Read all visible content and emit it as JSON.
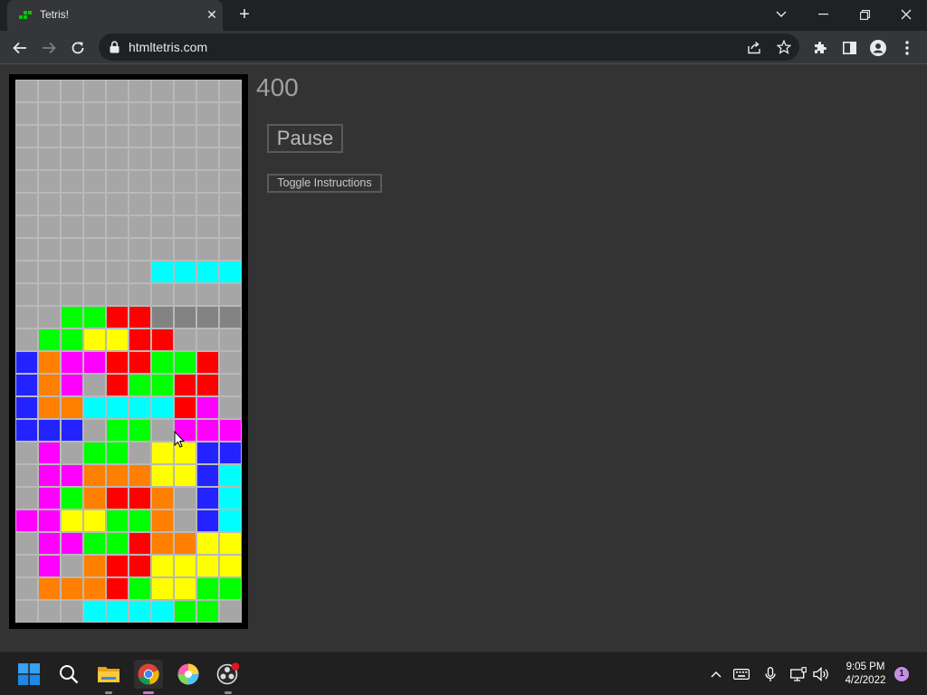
{
  "browser": {
    "tab_title": "Tetris!",
    "tab_close": "✕",
    "new_tab": "+",
    "url": "htmltetris.com"
  },
  "game": {
    "score": "400",
    "pause_label": "Pause",
    "toggle_instructions_label": "Toggle Instructions",
    "colors": {
      "E": "#a6a6a6",
      "D": "#838383",
      "G": "#00ff00",
      "R": "#ff0000",
      "Y": "#ffff00",
      "B": "#2323ff",
      "O": "#ff7f00",
      "M": "#ff00ff",
      "C": "#00ffff"
    },
    "grid": [
      "..........",
      "..........",
      "..........",
      "..........",
      "..........",
      "..........",
      "..........",
      "..........",
      "......CCCC",
      "..........",
      "..GGRRDDDD",
      ".GGYYRR...",
      "BOMMRRGGR.",
      "BOM.RGGRR.",
      "BOOCCCCRM.",
      "BBB.GG.MMM",
      ".M.GG.YYBB",
      ".MMOOOYYBC",
      ".MGORRO.BC",
      "MMYYGGO.BC",
      ".MMGGROOYY",
      ".M.ORRYYYY",
      ".OOORGYYGG",
      "...CCCCGG."
    ]
  },
  "taskbar": {
    "time": "9:05 PM",
    "date": "4/2/2022",
    "notification_count": "1"
  }
}
